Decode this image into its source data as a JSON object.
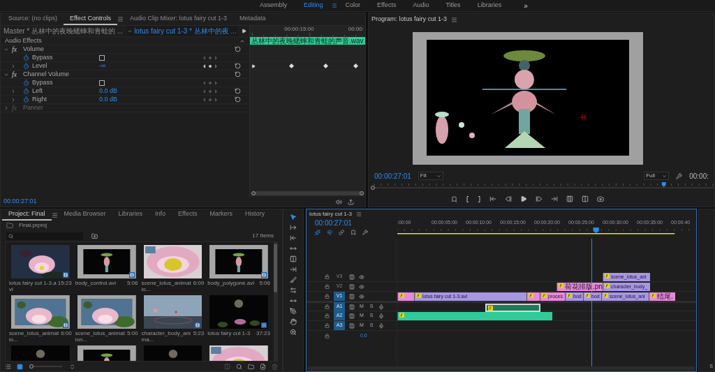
{
  "workspace": {
    "tabs": [
      {
        "label": "Assembly",
        "selected": false
      },
      {
        "label": "Editing",
        "selected": true
      },
      {
        "label": "Color",
        "selected": false
      },
      {
        "label": "Effects",
        "selected": false
      },
      {
        "label": "Audio",
        "selected": false
      },
      {
        "label": "Titles",
        "selected": false
      },
      {
        "label": "Libraries",
        "selected": false
      }
    ],
    "more": "»"
  },
  "effect_controls": {
    "tabs": [
      {
        "label": "Source: (no clips)",
        "selected": false
      },
      {
        "label": "Effect Controls",
        "selected": true
      },
      {
        "label": "Audio Clip Mixer: lotus fairy cut 1-3",
        "selected": false
      },
      {
        "label": "Metadata",
        "selected": false
      }
    ],
    "master_label": "Master * 丛林中的夜晚蟋蟀和青蛙的 ...",
    "clip_selector": "lotus fairy cut 1-3 * 丛林中的夜 ...",
    "ruler_labels": [
      "00:00:15:00",
      "00:00:"
    ],
    "section": "Audio Effects",
    "effects": [
      {
        "fx": "fx",
        "name": "Volume",
        "enabled": true,
        "expanded": true,
        "params": [
          {
            "name": "Bypass",
            "kind": "checkbox",
            "checked": false
          },
          {
            "name": "Level",
            "kind": "value",
            "value": "-∞",
            "expanded": false,
            "keyframes": true
          }
        ]
      },
      {
        "fx": "fx",
        "name": "Channel Volume",
        "enabled": true,
        "expanded": true,
        "params": [
          {
            "name": "Bypass",
            "kind": "checkbox",
            "checked": false
          },
          {
            "name": "Left",
            "kind": "value",
            "value": "0.0 dB",
            "expanded": false,
            "keyframes": false
          },
          {
            "name": "Right",
            "kind": "value",
            "value": "0.0 dB",
            "expanded": false,
            "keyframes": false
          }
        ]
      },
      {
        "fx": "fx",
        "name": "Panner",
        "enabled": false,
        "expanded": false
      }
    ],
    "clip": "丛林中的夜晚蟋蟀和青蛙的声音.wav",
    "timecode": "00:00:27:01"
  },
  "program": {
    "title": "Program: lotus fairy cut 1-3",
    "timecode": "00:00:27:01",
    "fit": "Fit",
    "quality": "Full",
    "duration": "00:00:"
  },
  "project": {
    "tabs": [
      {
        "label": "Project: Final",
        "selected": true
      },
      {
        "label": "Media Browser",
        "selected": false
      },
      {
        "label": "Libraries",
        "selected": false
      },
      {
        "label": "Info",
        "selected": false
      },
      {
        "label": "Effects",
        "selected": false
      },
      {
        "label": "Markers",
        "selected": false
      },
      {
        "label": "History",
        "selected": false
      }
    ],
    "file": "Final.prproj",
    "count": "17 Items",
    "thumbnail_zoom": {
      "level": 0
    },
    "items": [
      {
        "kind": "video",
        "name": "lotus fairy cut 1-3.avi",
        "duration": "15:23"
      },
      {
        "kind": "video",
        "name": "body_control.avi",
        "duration": "5:06"
      },
      {
        "kind": "still",
        "name": "scene_lotus_animatio...",
        "duration": "6:09"
      },
      {
        "kind": "video",
        "name": "body_polygone.avi",
        "duration": "5:06"
      },
      {
        "kind": "video",
        "name": "scene_lotus_animatio...",
        "duration": "6:00"
      },
      {
        "kind": "still",
        "name": "scene_lotus_animation...",
        "duration": "5:00"
      },
      {
        "kind": "video",
        "name": "character_body_anima...",
        "duration": "5:23"
      },
      {
        "kind": "sequence",
        "name": "lotus fairy cut 1-3",
        "duration": "37:23"
      },
      {
        "kind": "thumbnail"
      },
      {
        "kind": "thumbnail"
      },
      {
        "kind": "thumbnail"
      },
      {
        "kind": "thumbnail"
      }
    ]
  },
  "timeline": {
    "title": "lotus fairy cut 1-3",
    "timecode": "00:00:27:01",
    "ruler": [
      ":00:00",
      "00:00:05:00",
      "00:00:10:00",
      "00:00:15:00",
      "00:00:20:00",
      "00:00:25:00",
      "00:00:30:00",
      "00:00:35:00",
      "00:00:40"
    ],
    "tracks": [
      {
        "label": "V3",
        "kind": "video",
        "selected": false,
        "clips": [
          {
            "label": "scene_lotus_ani",
            "color": "#a796e2",
            "selected": false
          }
        ]
      },
      {
        "label": "V2",
        "kind": "video",
        "selected": false,
        "clips": [
          {
            "label": "荷花排版.pn",
            "color": "#e68ad8",
            "selected": false
          },
          {
            "label": "character_body_",
            "color": "#a796e2",
            "selected": false
          }
        ]
      },
      {
        "label": "V1",
        "kind": "video",
        "selected": true,
        "clips": [
          {
            "color": "#e68ad8",
            "selected": false
          },
          {
            "label": "lotus fairy cut 1-3.avi",
            "color": "#a796e2",
            "selected": false
          },
          {
            "color": "#e68ad8",
            "selected": false
          },
          {
            "label": "proces",
            "color": "#e68ad8",
            "selected": false
          },
          {
            "label": "bod",
            "color": "#a796e2",
            "selected": false
          },
          {
            "label": "bod",
            "color": "#a796e2",
            "selected": false
          },
          {
            "label": "scene_lotus_ani",
            "color": "#a796e2",
            "selected": false
          },
          {
            "label": "结尾.",
            "color": "#e68ad8",
            "selected": false
          }
        ]
      },
      {
        "label": "A1",
        "kind": "audio",
        "selected": true,
        "buttons": [
          "M",
          "S"
        ],
        "clips": [
          {
            "color": "#1f7a5a",
            "selected": true
          }
        ]
      },
      {
        "label": "A2",
        "kind": "audio",
        "selected": true,
        "buttons": [
          "M",
          "S"
        ],
        "clips": [
          {
            "color": "#2dcc98",
            "selected": false
          }
        ]
      },
      {
        "label": "A3",
        "kind": "audio",
        "selected": true,
        "buttons": [
          "M",
          "S"
        ]
      }
    ],
    "master_value": "0.0"
  },
  "meter": {
    "label": "S"
  }
}
